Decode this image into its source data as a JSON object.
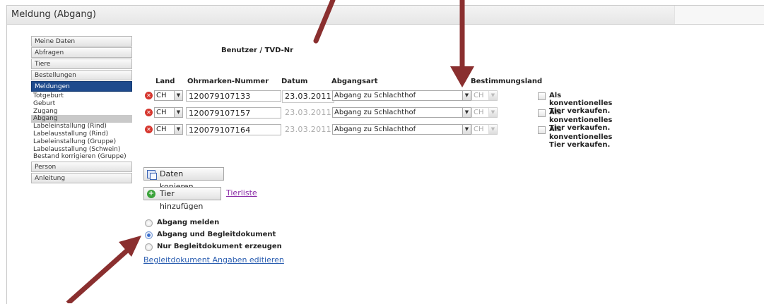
{
  "window": {
    "title": "Meldung (Abgang)"
  },
  "sidebar": {
    "items_top": [
      "Meine Daten",
      "Abfragen",
      "Tiere",
      "Bestellungen"
    ],
    "active": "Meldungen",
    "subitems": [
      "Totgeburt",
      "Geburt",
      "Zugang",
      "Abgang",
      "Labeleinstallung (Rind)",
      "Labelausstallung (Rind)",
      "Labeleinstallung (Gruppe)",
      "Labelausstallung (Schwein)",
      "Bestand korrigieren (Gruppe)"
    ],
    "selected_subitem": "Abgang",
    "items_bottom": [
      "Person",
      "Anleitung"
    ]
  },
  "form": {
    "user_label": "Benutzer / TVD-Nr",
    "headers": {
      "land": "Land",
      "ohrmarke": "Ohrmarken-Nummer",
      "datum": "Datum",
      "abgangsart": "Abgangsart",
      "bestimmungsland": "Bestimmungsland"
    },
    "rows": [
      {
        "land": "CH",
        "ohrmarke": "120079107133",
        "datum": "23.03.2011",
        "abgangsart": "Abgang zu Schlachthof",
        "bestimmungsland": "CH",
        "checkbox_label": "Als konventionelles Tier verkaufen."
      },
      {
        "land": "CH",
        "ohrmarke": "120079107157",
        "datum": "23.03.2011",
        "abgangsart": "Abgang zu Schlachthof",
        "bestimmungsland": "CH",
        "checkbox_label": "Als konventionelles Tier verkaufen."
      },
      {
        "land": "CH",
        "ohrmarke": "120079107164",
        "datum": "23.03.2011",
        "abgangsart": "Abgang zu Schlachthof",
        "bestimmungsland": "CH",
        "checkbox_label": "Als konventionelles Tier verkaufen."
      }
    ]
  },
  "buttons": {
    "copy": "Daten kopieren",
    "add": "Tier hinzufügen",
    "tierliste": "Tierliste"
  },
  "options": {
    "radios": [
      "Abgang melden",
      "Abgang und Begleitdokument",
      "Nur Begleitdokument erzeugen"
    ],
    "selected": "Abgang und Begleitdokument",
    "edit_link": "Begleitdokument Angaben editieren"
  },
  "annotation_color": "#8a2f2f"
}
